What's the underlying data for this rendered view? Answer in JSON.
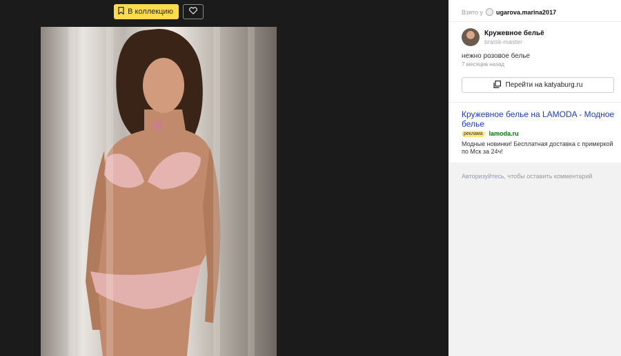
{
  "toolbar": {
    "collect_label": "В коллекцию",
    "bookmark_icon": "bookmark-icon",
    "like_icon": "heart-icon",
    "accent": "#ffdb4d"
  },
  "photo": {
    "subject": "image"
  },
  "sidebar": {
    "taken_prefix": "Взято у",
    "taken_user": "ugarova.marina2017",
    "board_title": "Кружевное бельё",
    "board_author": "bratsk-master",
    "description": "нежно розовое белье",
    "time": "7 месяцев назад",
    "goto_label": "Перейти на katyaburg.ru",
    "goto_icon": "copy-icon"
  },
  "ad": {
    "title": "Кружевное белье на LAMODA - Модное белье",
    "badge": "реклама",
    "domain": "lamoda.ru",
    "text": "Модные новинки! Бесплатная доставка с примеркой по Мск за 24ч!"
  },
  "comments": {
    "link": "Авторизуйтесь",
    "rest": ", чтобы оставить комментарий"
  }
}
